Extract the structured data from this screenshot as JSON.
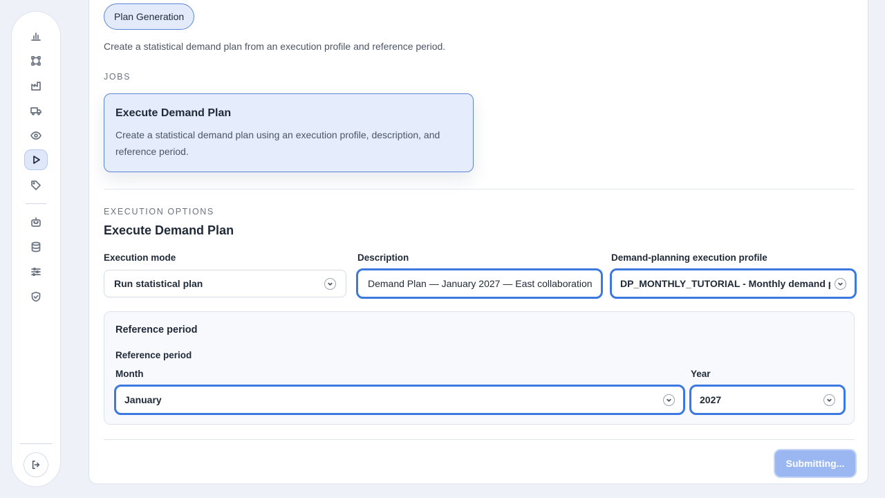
{
  "sidebar": {
    "items": [
      {
        "icon": "bar-chart-icon"
      },
      {
        "icon": "network-nodes-icon"
      },
      {
        "icon": "factory-icon"
      },
      {
        "icon": "truck-icon"
      },
      {
        "icon": "eye-icon"
      },
      {
        "icon": "play-icon",
        "active": true
      },
      {
        "icon": "tag-icon"
      },
      {
        "icon": "robot-icon"
      },
      {
        "icon": "database-icon"
      },
      {
        "icon": "sliders-icon"
      },
      {
        "icon": "shield-check-icon"
      }
    ],
    "logout_icon": "logout-icon"
  },
  "header": {
    "chip_label": "Plan Generation",
    "intro": "Create a statistical demand plan from an execution profile and reference period."
  },
  "jobs": {
    "section_label": "JOBS",
    "card": {
      "title": "Execute Demand Plan",
      "description": "Create a statistical demand plan using an execution profile, description, and reference period."
    }
  },
  "execution": {
    "section_label": "EXECUTION OPTIONS",
    "heading": "Execute Demand Plan",
    "mode_label": "Execution mode",
    "mode_value": "Run statistical plan",
    "description_label": "Description",
    "description_value": "Demand Plan — January 2027 — East collaboration",
    "profile_label": "Demand-planning execution profile",
    "profile_value": "DP_MONTHLY_TUTORIAL - Monthly demand p"
  },
  "reference": {
    "panel_title": "Reference period",
    "group_label": "Reference period",
    "month_label": "Month",
    "month_value": "January",
    "year_label": "Year",
    "year_value": "2027"
  },
  "actions": {
    "submit_label": "Submitting..."
  },
  "colors": {
    "accent": "#3b78e0",
    "card_bg": "#e5ecfc",
    "submit_disabled": "#9bb7f2"
  }
}
